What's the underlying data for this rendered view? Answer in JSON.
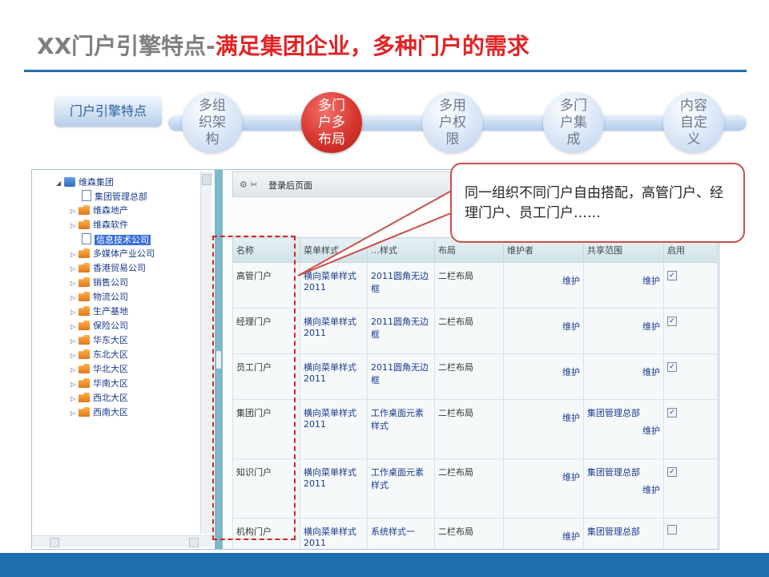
{
  "title": {
    "prefix": "XX门户引擎特点-",
    "highlight": "满足集团企业，多种门户的需求"
  },
  "nav": {
    "tab": "门户引擎特点",
    "steps": [
      {
        "label": "多组织架构",
        "active": false
      },
      {
        "label": "多门户多布局",
        "active": true
      },
      {
        "label": "多用户权限",
        "active": false
      },
      {
        "label": "多门户集成",
        "active": false
      },
      {
        "label": "内容自定义",
        "active": false
      }
    ]
  },
  "tree": {
    "root": "维森集团",
    "items": [
      "集团管理总部",
      "维森地产",
      "维森软件",
      "信息技术公司",
      "多媒体产业公司",
      "香港贸易公司",
      "销售公司",
      "物流公司",
      "生产基地",
      "保险公司",
      "华东大区",
      "东北大区",
      "华北大区",
      "华南大区",
      "西北大区",
      "西南大区"
    ]
  },
  "toolbar": {
    "crumb": "登录后页面"
  },
  "table": {
    "headers": [
      "名称",
      "菜单样式",
      "…样式",
      "布局",
      "维护者",
      "共享范围",
      "启用"
    ],
    "rows": [
      {
        "name": "高管门户",
        "menu": "横向菜单样式2011",
        "style": "2011圆角无边框",
        "layout": "二栏布局",
        "maintainer": "维护",
        "scope": "",
        "scope2": "维护",
        "enabled": "✓"
      },
      {
        "name": "经理门户",
        "menu": "横向菜单样式2011",
        "style": "2011圆角无边框",
        "layout": "二栏布局",
        "maintainer": "维护",
        "scope": "",
        "scope2": "维护",
        "enabled": "✓"
      },
      {
        "name": "员工门户",
        "menu": "横向菜单样式2011",
        "style": "2011圆角无边框",
        "layout": "二栏布局",
        "maintainer": "维护",
        "scope": "",
        "scope2": "维护",
        "enabled": "✓"
      },
      {
        "name": "集团门户",
        "menu": "横向菜单样式2011",
        "style": "工作桌面元素样式",
        "layout": "二栏布局",
        "maintainer": "维护",
        "scope": "集团管理总部",
        "scope2": "维护",
        "enabled": "✓"
      },
      {
        "name": "知识门户",
        "menu": "横向菜单样式2011",
        "style": "工作桌面元素样式",
        "layout": "二栏布局",
        "maintainer": "维护",
        "scope": "集团管理总部",
        "scope2": "维护",
        "enabled": "✓"
      },
      {
        "name": "机构门户",
        "menu": "横向菜单样式2011",
        "style": "系统样式一",
        "layout": "二栏布局",
        "maintainer": "维护",
        "scope": "集团管理总部",
        "scope2": "",
        "enabled": ""
      }
    ]
  },
  "callout": {
    "text": "同一组织不同门户自由搭配，高管门户、经理门户、员工门户……"
  },
  "colors": {
    "accent_red": "#e02424",
    "title_grey": "#7f7f7f",
    "brand_blue": "#1f6fae"
  }
}
